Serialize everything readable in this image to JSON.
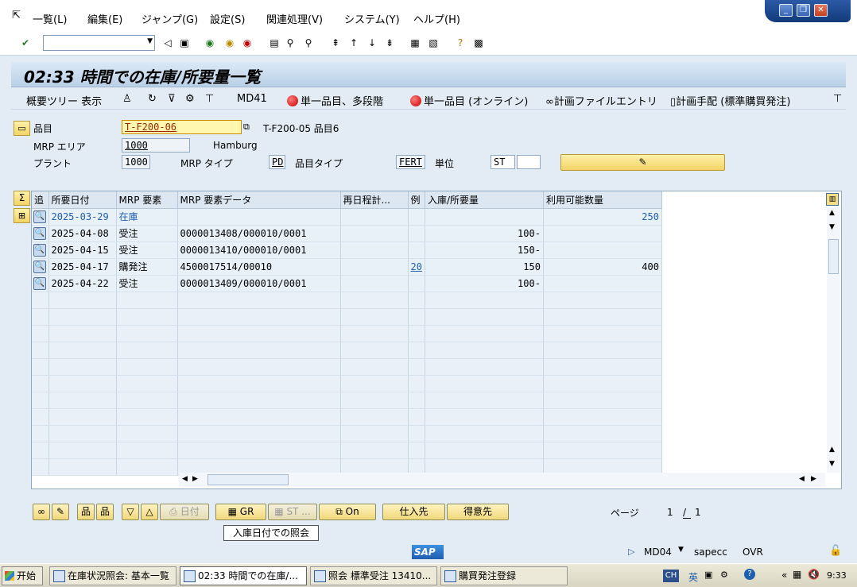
{
  "menu": [
    "一覧(L)",
    "編集(E)",
    "ジャンプ(G)",
    "設定(S)",
    "関連処理(V)",
    "システム(Y)",
    "ヘルプ(H)"
  ],
  "title": "02:33 時間での在庫/所要量一覧",
  "app_toolbar": {
    "overview_tree": "概要ツリー 表示",
    "md41": "MD41",
    "single_multi": "単一品目、多段階",
    "single_online": "単一品目 (オンライン)",
    "planning_file": "計画ファイルエントリ",
    "planning_proc": "計画手配 (標準購買発注)"
  },
  "header": {
    "material_label": "品目",
    "material_value": "T-F200-06",
    "material_desc": "T-F200-05 品目6",
    "mrp_area_label": "MRP エリア",
    "mrp_area_value": "1000",
    "mrp_area_name": "Hamburg",
    "plant_label": "プラント",
    "plant_value": "1000",
    "mrp_type_label": "MRP タイプ",
    "mrp_type_value": "PD",
    "mat_type_label": "品目タイプ",
    "mat_type_value": "FERT",
    "unit_label": "単位",
    "unit_value": "ST"
  },
  "table": {
    "columns": [
      "追",
      "所要日付",
      "MRP 要素",
      "MRP 要素データ",
      "再日程計...",
      "例",
      "入庫/所要量",
      "利用可能数量"
    ],
    "rows": [
      {
        "date": "2025-03-29",
        "element": "在庫",
        "data": "",
        "resched": "",
        "exc": "",
        "qty": "",
        "avail": "250"
      },
      {
        "date": "2025-04-08",
        "element": "受注",
        "data": "0000013408/000010/0001",
        "resched": "",
        "exc": "",
        "qty": "100-",
        "avail": ""
      },
      {
        "date": "2025-04-15",
        "element": "受注",
        "data": "0000013410/000010/0001",
        "resched": "",
        "exc": "",
        "qty": "150-",
        "avail": ""
      },
      {
        "date": "2025-04-17",
        "element": "購発注",
        "data": "4500017514/00010",
        "resched": "",
        "exc": "20",
        "qty": "150",
        "avail": "400"
      },
      {
        "date": "2025-04-22",
        "element": "受注",
        "data": "0000013409/000010/0001",
        "resched": "",
        "exc": "",
        "qty": "100-",
        "avail": ""
      }
    ]
  },
  "bottom": {
    "date_btn": "日付",
    "gr_btn": "GR",
    "st_btn": "ST ...",
    "on_btn": "On",
    "vendor_btn": "仕入先",
    "customer_btn": "得意先",
    "page_label": "ページ",
    "page_current": "1",
    "page_total": "1",
    "tooltip": "入庫日付での照会"
  },
  "status": {
    "sap_logo": "SAP",
    "tcode": "MD04",
    "server": "sapecc",
    "mode": "OVR"
  },
  "taskbar": {
    "start": "开始",
    "tasks": [
      "在庫状況照会: 基本一覧",
      "02:33 時間での在庫/...",
      "照会 標準受注 13410...",
      "購買発注登録"
    ],
    "lang": "CH",
    "ime": "英",
    "clock": "9:33"
  }
}
